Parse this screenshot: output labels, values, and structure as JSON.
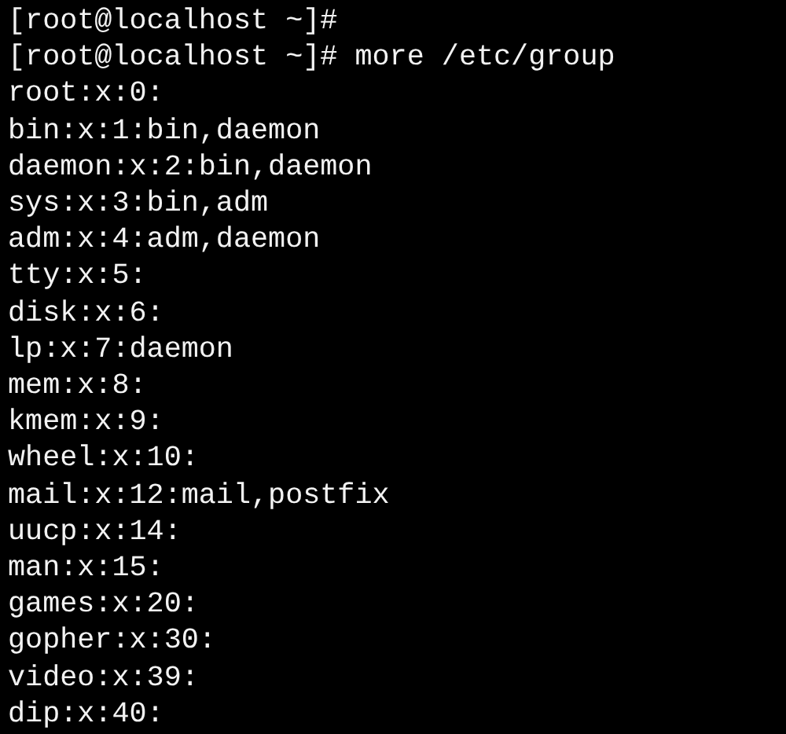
{
  "terminal": {
    "lines": [
      "[root@localhost ~]#",
      "[root@localhost ~]# more /etc/group",
      "root:x:0:",
      "bin:x:1:bin,daemon",
      "daemon:x:2:bin,daemon",
      "sys:x:3:bin,adm",
      "adm:x:4:adm,daemon",
      "tty:x:5:",
      "disk:x:6:",
      "lp:x:7:daemon",
      "mem:x:8:",
      "kmem:x:9:",
      "wheel:x:10:",
      "mail:x:12:mail,postfix",
      "uucp:x:14:",
      "man:x:15:",
      "games:x:20:",
      "gopher:x:30:",
      "video:x:39:",
      "dip:x:40:"
    ]
  }
}
